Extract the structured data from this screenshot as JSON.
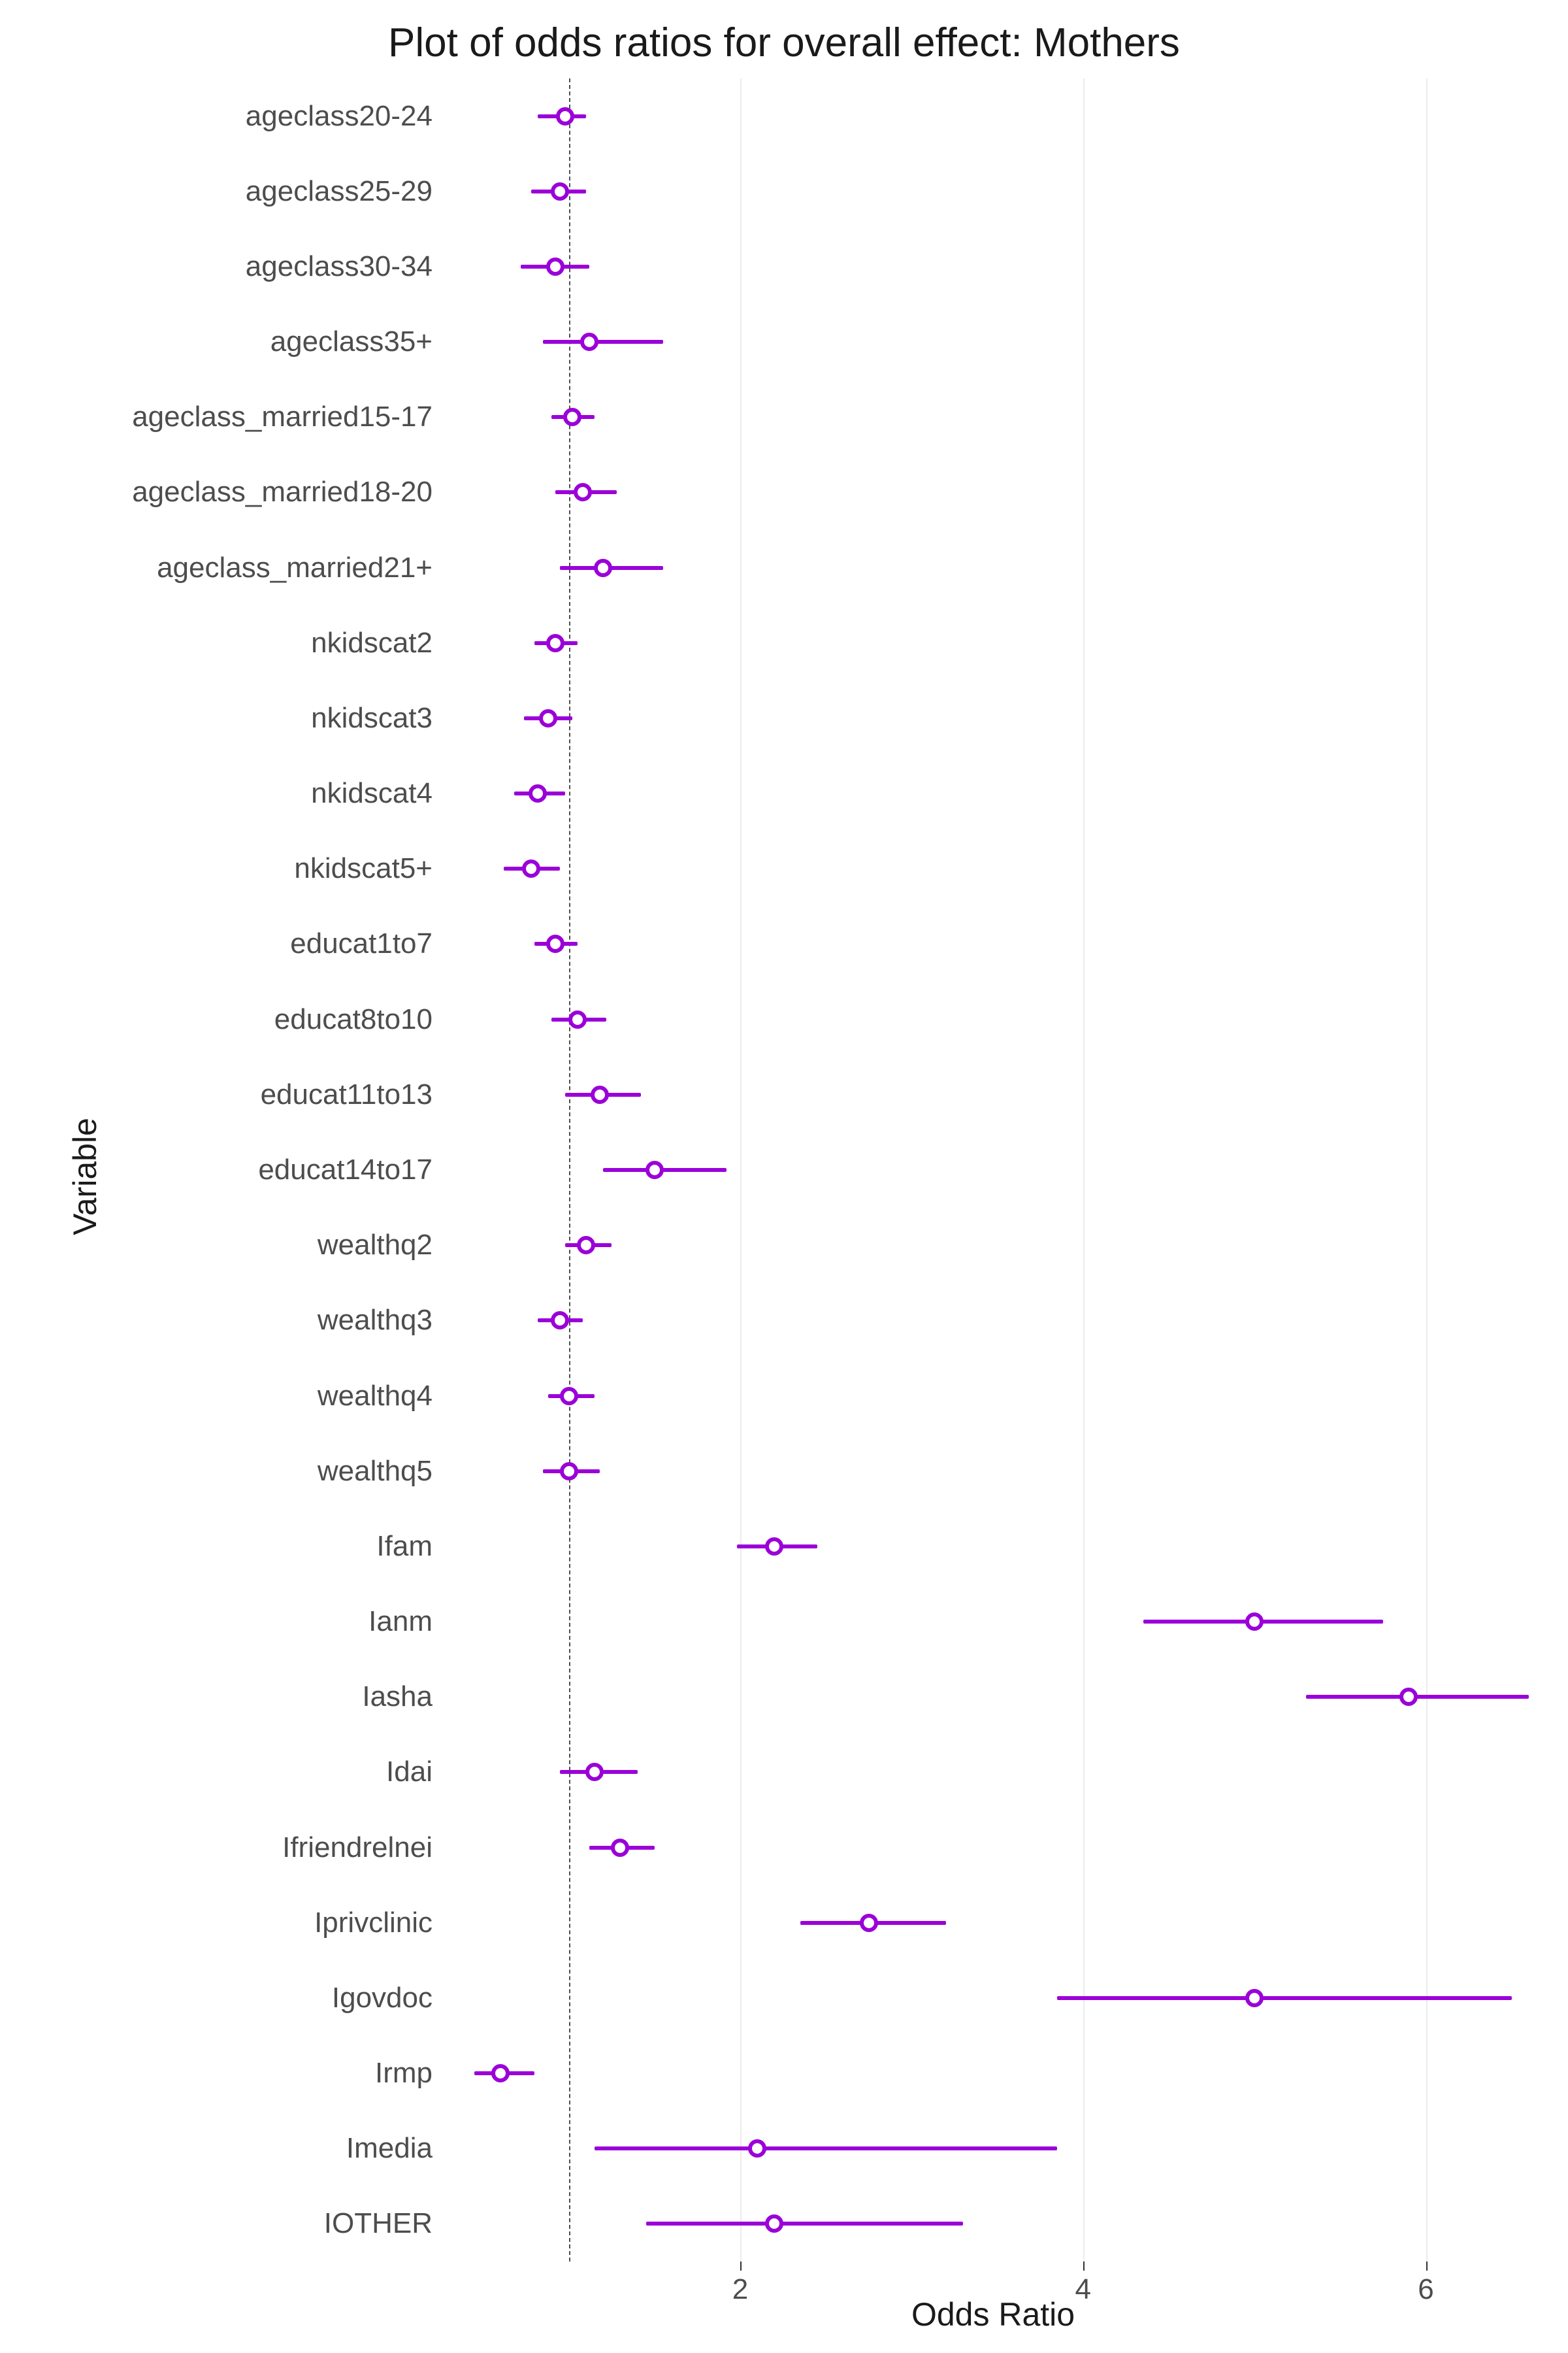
{
  "chart_data": {
    "type": "forest",
    "title": "Plot of odds ratios for overall effect: Mothers",
    "xlabel": "Odds Ratio",
    "ylabel": "Variable",
    "x_ticks": [
      2,
      4,
      6
    ],
    "x_range": [
      0.35,
      6.6
    ],
    "reference_line": 1,
    "color": "#9b00d9",
    "series": [
      {
        "variable": "ageclass20-24",
        "or": 0.98,
        "low": 0.82,
        "high": 1.1
      },
      {
        "variable": "ageclass25-29",
        "or": 0.95,
        "low": 0.78,
        "high": 1.1
      },
      {
        "variable": "ageclass30-34",
        "or": 0.92,
        "low": 0.72,
        "high": 1.12
      },
      {
        "variable": "ageclass35+",
        "or": 1.12,
        "low": 0.85,
        "high": 1.55
      },
      {
        "variable": "ageclass_married15-17",
        "or": 1.02,
        "low": 0.9,
        "high": 1.15
      },
      {
        "variable": "ageclass_married18-20",
        "or": 1.08,
        "low": 0.92,
        "high": 1.28
      },
      {
        "variable": "ageclass_married21+",
        "or": 1.2,
        "low": 0.95,
        "high": 1.55
      },
      {
        "variable": "nkidscat2",
        "or": 0.92,
        "low": 0.8,
        "high": 1.05
      },
      {
        "variable": "nkidscat3",
        "or": 0.88,
        "low": 0.74,
        "high": 1.02
      },
      {
        "variable": "nkidscat4",
        "or": 0.82,
        "low": 0.68,
        "high": 0.98
      },
      {
        "variable": "nkidscat5+",
        "or": 0.78,
        "low": 0.62,
        "high": 0.95
      },
      {
        "variable": "educat1to7",
        "or": 0.92,
        "low": 0.8,
        "high": 1.05
      },
      {
        "variable": "educat8to10",
        "or": 1.05,
        "low": 0.9,
        "high": 1.22
      },
      {
        "variable": "educat11to13",
        "or": 1.18,
        "low": 0.98,
        "high": 1.42
      },
      {
        "variable": "educat14to17",
        "or": 1.5,
        "low": 1.2,
        "high": 1.92
      },
      {
        "variable": "wealthq2",
        "or": 1.1,
        "low": 0.98,
        "high": 1.25
      },
      {
        "variable": "wealthq3",
        "or": 0.95,
        "low": 0.82,
        "high": 1.08
      },
      {
        "variable": "wealthq4",
        "or": 1.0,
        "low": 0.88,
        "high": 1.15
      },
      {
        "variable": "wealthq5",
        "or": 1.0,
        "low": 0.85,
        "high": 1.18
      },
      {
        "variable": "Ifam",
        "or": 2.2,
        "low": 1.98,
        "high": 2.45
      },
      {
        "variable": "Ianm",
        "or": 5.0,
        "low": 4.35,
        "high": 5.75
      },
      {
        "variable": "Iasha",
        "or": 5.9,
        "low": 5.3,
        "high": 6.6
      },
      {
        "variable": "Idai",
        "or": 1.15,
        "low": 0.95,
        "high": 1.4
      },
      {
        "variable": "Ifriendrelnei",
        "or": 1.3,
        "low": 1.12,
        "high": 1.5
      },
      {
        "variable": "Iprivclinic",
        "or": 2.75,
        "low": 2.35,
        "high": 3.2
      },
      {
        "variable": "Igovdoc",
        "or": 5.0,
        "low": 3.85,
        "high": 6.5
      },
      {
        "variable": "Irmp",
        "or": 0.6,
        "low": 0.45,
        "high": 0.8
      },
      {
        "variable": "Imedia",
        "or": 2.1,
        "low": 1.15,
        "high": 3.85
      },
      {
        "variable": "IOTHER",
        "or": 2.2,
        "low": 1.45,
        "high": 3.3
      }
    ]
  }
}
